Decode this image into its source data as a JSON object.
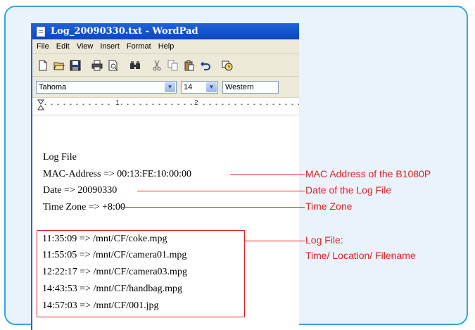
{
  "window": {
    "title": "Log_20090330.txt - WordPad"
  },
  "menu": {
    "file": "File",
    "edit": "Edit",
    "view": "View",
    "insert": "Insert",
    "format": "Format",
    "help": "Help"
  },
  "toolbar": {
    "icons": [
      "new-icon",
      "open-icon",
      "save-icon",
      "print-icon",
      "print-preview-icon",
      "find-icon",
      "cut-icon",
      "copy-icon",
      "paste-icon",
      "undo-icon",
      "date-time-icon"
    ]
  },
  "format_bar": {
    "font": "Tahoma",
    "size": "14",
    "script": "Western"
  },
  "ruler": {
    "mark1": "1",
    "mark2": "2"
  },
  "document": {
    "lines": [
      "Log File",
      "MAC-Address => 00:13:FE:10:00:00",
      "Date => 20090330",
      "Time Zone => +8:00"
    ],
    "log_entries": [
      "11:35:09 => /mnt/CF/coke.mpg",
      "11:55:05 => /mnt/CF/camera01.mpg",
      "12:22:17 => /mnt/CF/camera03.mpg",
      "14:43:53 => /mnt/CF/handbag.mpg",
      "14:57:03 => /mnt/CF/001.jpg"
    ]
  },
  "annotations": {
    "mac": "MAC Address of the B1080P",
    "date": "Date of the Log File",
    "timezone": "Time Zone",
    "log_line1": "Log File:",
    "log_line2": "Time/ Location/ Filename"
  },
  "colors": {
    "frame_border": "#3aa6d8",
    "frame_fill": "#e8f3fb",
    "annotation": "#e52020",
    "titlebar": "#0a47c0"
  }
}
